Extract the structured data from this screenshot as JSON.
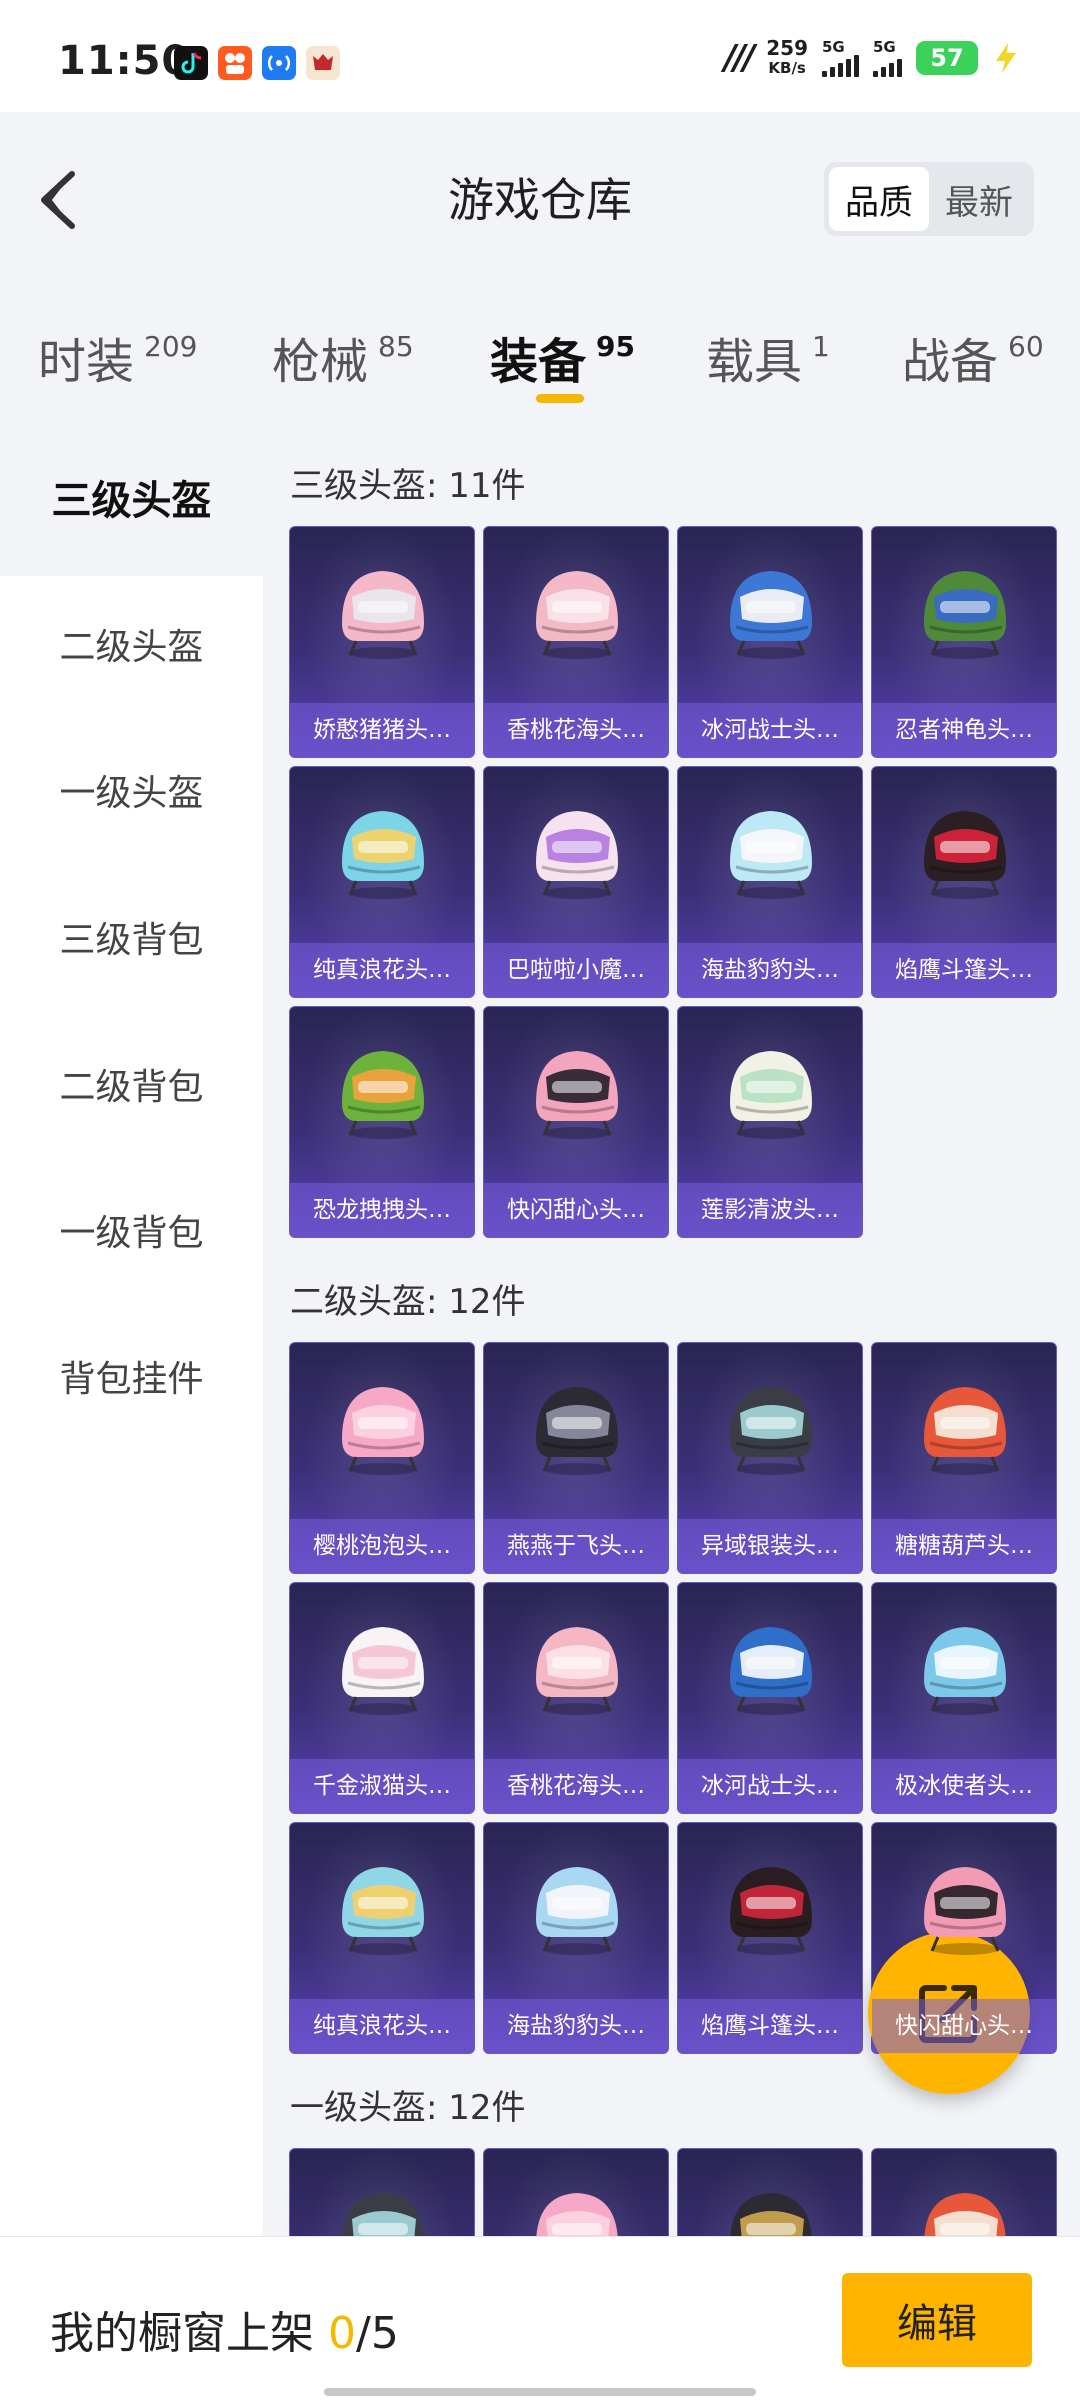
{
  "status_bar": {
    "time": "11:50",
    "network_speed_value": "259",
    "network_speed_unit": "KB/s",
    "sim1_label": "5G",
    "sim2_label": "5G",
    "battery_level": "57",
    "apps": [
      "douyin-app-icon",
      "kuaishou-app-icon",
      "hotspot-app-icon",
      "game-app-icon"
    ]
  },
  "header": {
    "title": "游戏仓库",
    "sort_options": [
      "品质",
      "最新"
    ],
    "sort_selected": "品质"
  },
  "tabs": [
    {
      "label": "时装",
      "count": "209"
    },
    {
      "label": "枪械",
      "count": "85"
    },
    {
      "label": "装备",
      "count": "95"
    },
    {
      "label": "载具",
      "count": "1"
    },
    {
      "label": "战备",
      "count": "60"
    }
  ],
  "active_tab": "装备",
  "sidebar": {
    "items": [
      "三级头盔",
      "二级头盔",
      "一级头盔",
      "三级背包",
      "二级背包",
      "一级背包",
      "背包挂件"
    ],
    "active": "三级头盔"
  },
  "sections": [
    {
      "title": "三级头盔: 11件",
      "items": [
        {
          "name": "娇憨猪猪头…",
          "colors": [
            "#f4b8c8",
            "#e7e7ee"
          ]
        },
        {
          "name": "香桃花海头…",
          "colors": [
            "#f3b9c6",
            "#fae3ea"
          ]
        },
        {
          "name": "冰河战士头…",
          "colors": [
            "#3e78d6",
            "#f2f2f6"
          ]
        },
        {
          "name": "忍者神龟头…",
          "colors": [
            "#4f8a3b",
            "#3a69c7"
          ]
        },
        {
          "name": "纯真浪花头…",
          "colors": [
            "#7cd4e8",
            "#f2d36b"
          ]
        },
        {
          "name": "巴啦啦小魔…",
          "colors": [
            "#f6e2ee",
            "#b57be0"
          ]
        },
        {
          "name": "海盐豹豹头…",
          "colors": [
            "#bde8f5",
            "#f7f7fb"
          ]
        },
        {
          "name": "焰鹰斗篷头…",
          "colors": [
            "#2b1f24",
            "#d4233a"
          ]
        },
        {
          "name": "恐龙拽拽头…",
          "colors": [
            "#6db23a",
            "#f0a23c"
          ]
        },
        {
          "name": "快闪甜心头…",
          "colors": [
            "#f2a5bd",
            "#2c2530"
          ]
        },
        {
          "name": "莲影清波头…",
          "colors": [
            "#f1f1e6",
            "#b5e2c2"
          ]
        }
      ]
    },
    {
      "title": "二级头盔: 12件",
      "items": [
        {
          "name": "樱桃泡泡头…",
          "colors": [
            "#f6a8c6",
            "#fbd3e2"
          ]
        },
        {
          "name": "燕燕于飞头…",
          "colors": [
            "#2c2a33",
            "#8a8ba0"
          ]
        },
        {
          "name": "异域银装头…",
          "colors": [
            "#3b3d46",
            "#9fd2d6"
          ]
        },
        {
          "name": "糖糖葫芦头…",
          "colors": [
            "#e7573a",
            "#f4e6d8"
          ]
        },
        {
          "name": "千金淑猫头…",
          "colors": [
            "#f7f3f6",
            "#f3c3d4"
          ]
        },
        {
          "name": "香桃花海头…",
          "colors": [
            "#f5b7c3",
            "#fbe1e7"
          ]
        },
        {
          "name": "冰河战士头…",
          "colors": [
            "#2f6fc9",
            "#eef3fb"
          ]
        },
        {
          "name": "极冰使者头…",
          "colors": [
            "#7bc8ea",
            "#eef8fd"
          ]
        },
        {
          "name": "纯真浪花头…",
          "colors": [
            "#8fd7e6",
            "#f4d06a"
          ]
        },
        {
          "name": "海盐豹豹头…",
          "colors": [
            "#a9d8f2",
            "#f5f6fb"
          ]
        },
        {
          "name": "焰鹰斗篷头…",
          "colors": [
            "#2a1d22",
            "#c8263a"
          ]
        },
        {
          "name": "快闪甜心头…",
          "colors": [
            "#f39ab5",
            "#2a2229"
          ]
        }
      ]
    },
    {
      "title": "一级头盔: 12件",
      "items": [
        {
          "name": "",
          "colors": [
            "#3b3d46",
            "#9fd2d6"
          ]
        },
        {
          "name": "",
          "colors": [
            "#f6a8c6",
            "#fbd3e2"
          ]
        },
        {
          "name": "",
          "colors": [
            "#2c2a33",
            "#c9a24e"
          ]
        },
        {
          "name": "",
          "colors": [
            "#e7573a",
            "#f4e6d8"
          ]
        }
      ]
    }
  ],
  "bottom_bar": {
    "label": "我的橱窗上架",
    "count": "0",
    "separator": "/",
    "total": "5",
    "edit_label": "编辑"
  },
  "accent_color": "#f5b800"
}
